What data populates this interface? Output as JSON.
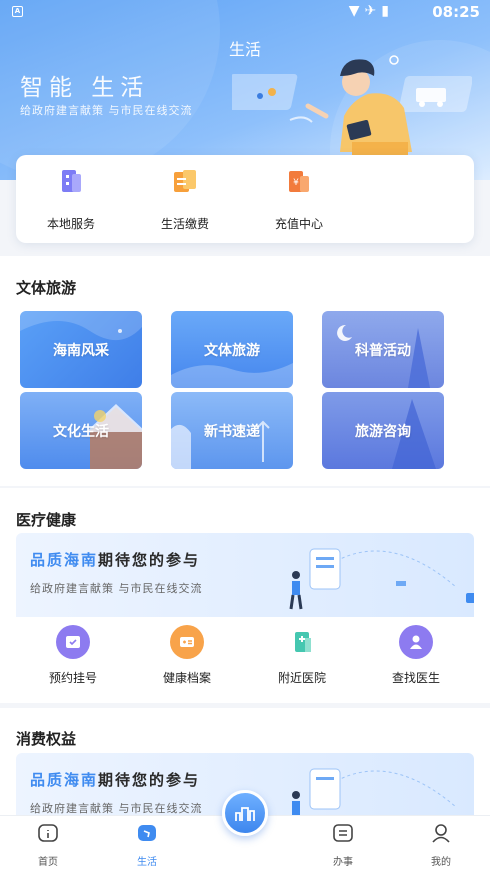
{
  "status_bar": {
    "time": "08:25",
    "app_badge": "A"
  },
  "header": {
    "title": "生活",
    "headline": "智能 生活",
    "subline": "给政府建言献策 与市民在线交流"
  },
  "quick_services": [
    {
      "label": "本地服务",
      "icon": "building-icon",
      "color": "#7d7cf5"
    },
    {
      "label": "生活缴费",
      "icon": "bill-icon",
      "color": "#f7a03b"
    },
    {
      "label": "充值中心",
      "icon": "recharge-icon",
      "color": "#f27b3c"
    }
  ],
  "culture": {
    "title": "文体旅游",
    "tiles": [
      {
        "label": "海南风采"
      },
      {
        "label": "文体旅游"
      },
      {
        "label": "科普活动"
      },
      {
        "label": "文化生活"
      },
      {
        "label": "新书速递"
      },
      {
        "label": "旅游咨询"
      }
    ]
  },
  "medical": {
    "title": "医疗健康",
    "banner_highlight": "品质海南",
    "banner_rest": "期待您的参与",
    "banner_sub": "给政府建言献策 与市民在线交流",
    "items": [
      {
        "label": "预约挂号",
        "icon": "appointment-icon",
        "color": "#8d7bf0"
      },
      {
        "label": "健康档案",
        "icon": "health-record-icon",
        "color": "#f8a34a"
      },
      {
        "label": "附近医院",
        "icon": "hospital-icon",
        "color": "#45c7b0"
      },
      {
        "label": "查找医生",
        "icon": "doctor-icon",
        "color": "#8d7bf0"
      }
    ]
  },
  "consumer": {
    "title": "消费权益",
    "banner_highlight": "品质海南",
    "banner_rest": "期待您的参与",
    "banner_sub": "给政府建言献策 与市民在线交流"
  },
  "bottom_nav": [
    {
      "label": "首页",
      "icon": "home-icon",
      "active": false
    },
    {
      "label": "生活",
      "icon": "life-icon",
      "active": true
    },
    {
      "label": "办事",
      "icon": "tasks-icon",
      "active": false
    },
    {
      "label": "我的",
      "icon": "profile-icon",
      "active": false
    }
  ],
  "colors": {
    "accent": "#3f8bf0",
    "header_top": "#5da2f5"
  }
}
